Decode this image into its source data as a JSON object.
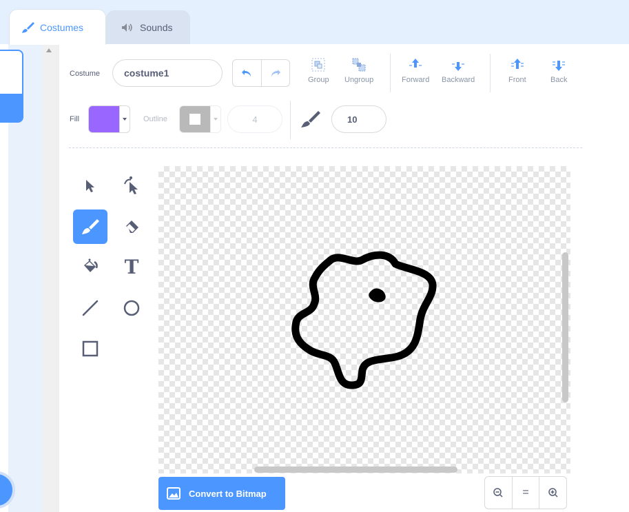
{
  "tabs": [
    {
      "label": "Costumes",
      "icon": "brush-icon",
      "active": true
    },
    {
      "label": "Sounds",
      "icon": "speaker-icon",
      "active": false
    }
  ],
  "toolbar": {
    "costume_label": "Costume",
    "costume_name": "costume1",
    "group_label": "Group",
    "ungroup_label": "Ungroup",
    "forward_label": "Forward",
    "backward_label": "Backward",
    "front_label": "Front",
    "back_label": "Back"
  },
  "fill": {
    "label": "Fill",
    "color": "#9966ff"
  },
  "outline": {
    "label": "Outline",
    "width": "4"
  },
  "brush": {
    "size": "10"
  },
  "tools": [
    {
      "name": "select-tool",
      "icon": "arrow-icon"
    },
    {
      "name": "reshape-tool",
      "icon": "reshape-icon"
    },
    {
      "name": "brush-tool",
      "icon": "brush-icon",
      "active": true
    },
    {
      "name": "eraser-tool",
      "icon": "eraser-icon"
    },
    {
      "name": "fill-tool",
      "icon": "bucket-icon"
    },
    {
      "name": "text-tool",
      "icon": "text-icon",
      "glyph": "T"
    },
    {
      "name": "line-tool",
      "icon": "line-icon"
    },
    {
      "name": "circle-tool",
      "icon": "circle-icon"
    },
    {
      "name": "rectangle-tool",
      "icon": "rectangle-icon"
    }
  ],
  "footer": {
    "convert_label": "Convert to Bitmap",
    "zoom_reset": "="
  },
  "colors": {
    "accent": "#4c97ff",
    "text": "#575e75"
  }
}
